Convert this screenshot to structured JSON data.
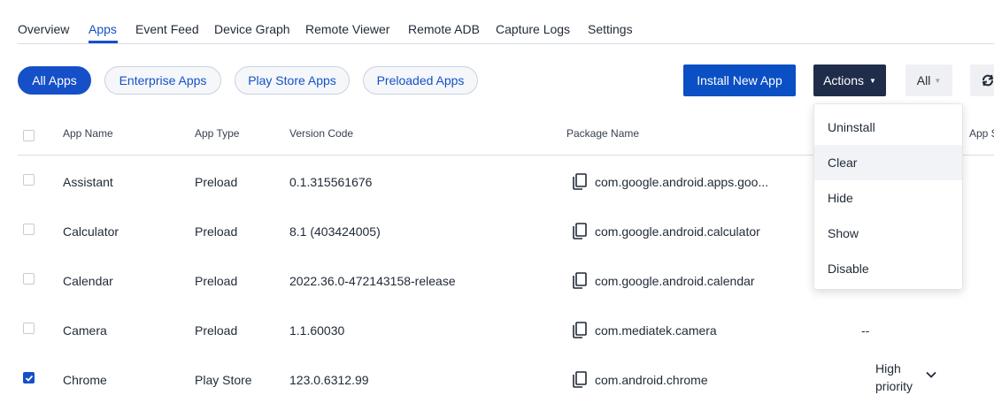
{
  "tabs": [
    {
      "label": "Overview",
      "active": false
    },
    {
      "label": "Apps",
      "active": true
    },
    {
      "label": "Event Feed",
      "active": false
    },
    {
      "label": "Device Graph",
      "active": false
    },
    {
      "label": "Remote Viewer",
      "active": false
    },
    {
      "label": "Remote ADB",
      "active": false
    },
    {
      "label": "Capture Logs",
      "active": false
    },
    {
      "label": "Settings",
      "active": false
    }
  ],
  "filters": [
    {
      "label": "All Apps",
      "active": true
    },
    {
      "label": "Enterprise Apps",
      "active": false
    },
    {
      "label": "Play Store Apps",
      "active": false
    },
    {
      "label": "Preloaded Apps",
      "active": false
    }
  ],
  "toolbar": {
    "install_label": "Install New App",
    "actions_label": "Actions",
    "filter_select_value": "All"
  },
  "actions_menu": {
    "items": [
      "Uninstall",
      "Clear",
      "Hide",
      "Show",
      "Disable"
    ],
    "hovered": "Clear"
  },
  "table": {
    "columns": [
      "App Name",
      "App Type",
      "Version Code",
      "Package Name",
      "App S"
    ],
    "rows": [
      {
        "name": "Assistant",
        "type": "Preload",
        "version": "0.1.315561676",
        "package": "com.google.android.apps.goo...",
        "status": "",
        "checked": false
      },
      {
        "name": "Calculator",
        "type": "Preload",
        "version": "8.1 (403424005)",
        "package": "com.google.android.calculator",
        "status": "",
        "checked": false
      },
      {
        "name": "Calendar",
        "type": "Preload",
        "version": "2022.36.0-472143158-release",
        "package": "com.google.android.calendar",
        "status": "",
        "checked": false
      },
      {
        "name": "Camera",
        "type": "Preload",
        "version": "1.1.60030",
        "package": "com.mediatek.camera",
        "status": "--",
        "checked": false
      },
      {
        "name": "Chrome",
        "type": "Play Store",
        "version": "123.0.6312.99",
        "package": "com.android.chrome",
        "status": "High priority",
        "checked": true
      }
    ]
  },
  "colors": {
    "accent": "#1550c8",
    "primary_button": "#0b4fc4",
    "dark_button": "#1f2d4a",
    "border": "#d9dde3"
  },
  "icons": {
    "copy": "copy-icon",
    "refresh": "refresh-icon",
    "caret": "caret-down-icon",
    "chevron": "chevron-down-icon",
    "check": "check-icon"
  }
}
